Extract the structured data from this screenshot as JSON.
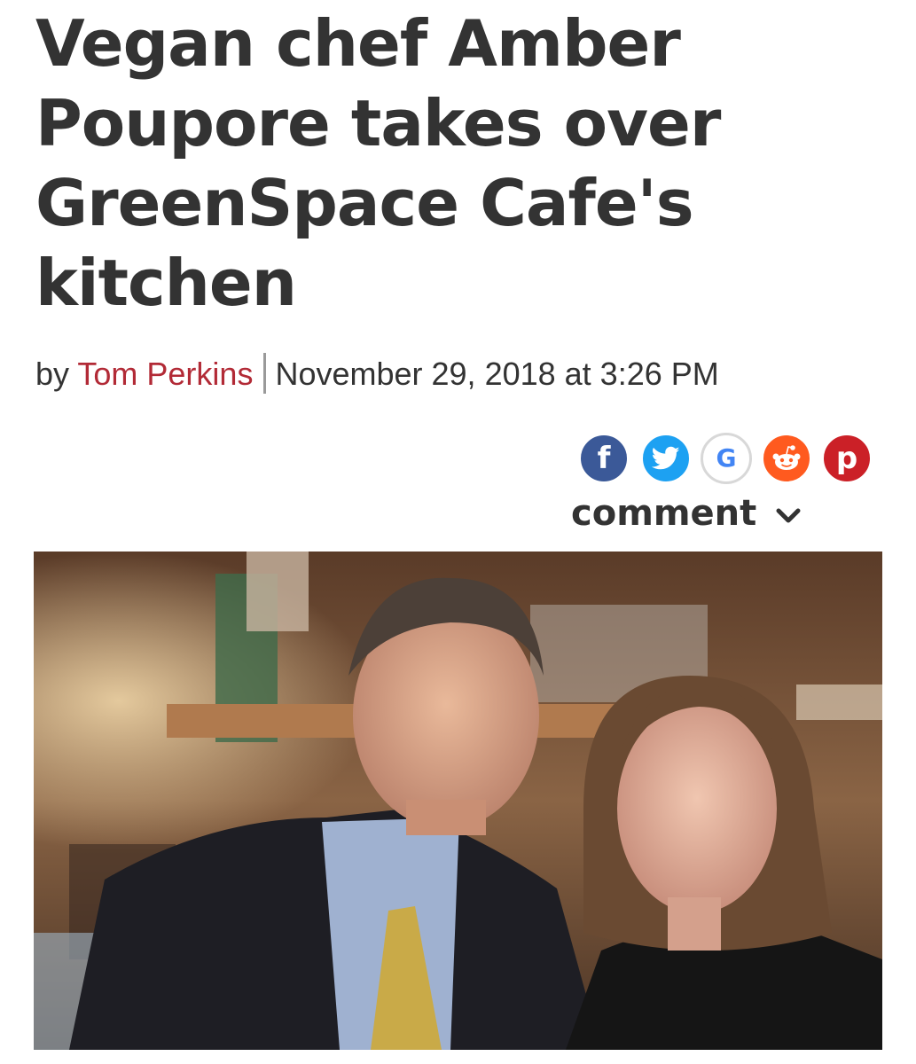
{
  "article": {
    "headline_lines": [
      "Vegan chef Amber",
      "Poupore takes over",
      "GreenSpace Cafe's",
      "kitchen"
    ],
    "byline_prefix": "by",
    "author": "Tom Perkins",
    "date": "November 29, 2018 at 3:26 PM"
  },
  "share": {
    "buttons": [
      {
        "name": "facebook",
        "glyph": "f",
        "color": "#3b5998"
      },
      {
        "name": "twitter",
        "glyph": "bird",
        "color": "#1da1f2"
      },
      {
        "name": "google",
        "glyph": "G",
        "color": "#4285f4"
      },
      {
        "name": "reddit",
        "glyph": "alien",
        "color": "#ff5a1f"
      },
      {
        "name": "pinterest",
        "glyph": "p",
        "color": "#cb2027"
      }
    ]
  },
  "comment": {
    "label": "comment"
  },
  "colors": {
    "headline": "#333333",
    "author_link": "#b22a36"
  }
}
